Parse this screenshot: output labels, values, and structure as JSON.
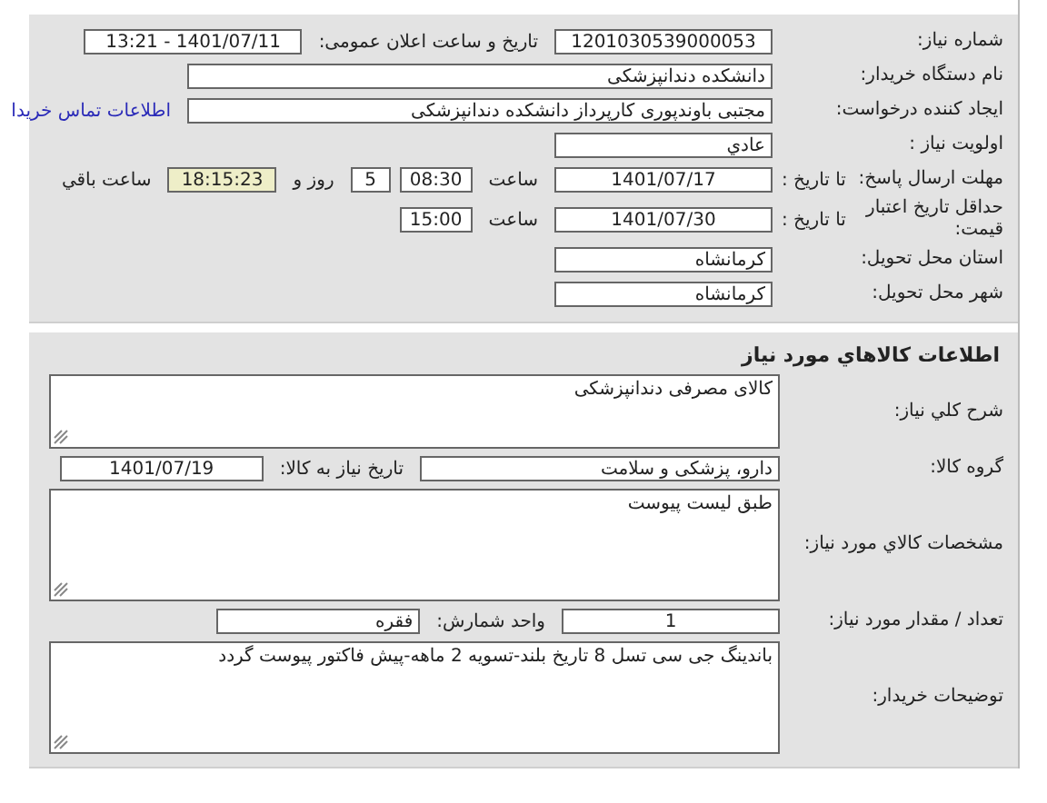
{
  "sections": [
    {
      "rows": [
        {
          "label": "شماره نياز:",
          "items": [
            {
              "kind": "field",
              "value": "1201030539000053"
            },
            {
              "kind": "text",
              "text": "تاريخ و ساعت اعلان عمومی:"
            },
            {
              "kind": "field",
              "value": "1401/07/11 - 13:21"
            }
          ]
        },
        {
          "label": "نام دستگاه خريدار:",
          "items": [
            {
              "kind": "wide",
              "value": "دانشکده دندانپزشکی"
            }
          ]
        },
        {
          "label": "ايجاد کننده درخواست:",
          "items": [
            {
              "kind": "wide",
              "value": "مجتبی  باوندپوری کارپرداز دانشکده دندانپزشکی"
            },
            {
              "kind": "link",
              "text": "اطلاعات تماس خریدا"
            }
          ]
        },
        {
          "label": "اولويت نياز :",
          "items": [
            {
              "kind": "field",
              "value": "عادي"
            }
          ]
        },
        {
          "label": "مهلت ارسال پاسخ:",
          "sublabel": "تا تاريخ :",
          "items": [
            {
              "kind": "field",
              "value": "1401/07/17"
            },
            {
              "kind": "text",
              "text": "ساعت"
            },
            {
              "kind": "small",
              "value": "08:30"
            },
            {
              "kind": "tiny",
              "value": "5"
            },
            {
              "kind": "text",
              "text": "روز و"
            },
            {
              "kind": "timer",
              "value": "18:15:23"
            },
            {
              "kind": "text",
              "text": "ساعت باقي"
            }
          ]
        },
        {
          "label": "حداقل تاريخ اعتبار قيمت:",
          "sublabel": "تا تاريخ :",
          "items": [
            {
              "kind": "field",
              "value": "1401/07/30"
            },
            {
              "kind": "text",
              "text": "ساعت"
            },
            {
              "kind": "small",
              "value": "15:00"
            }
          ]
        },
        {
          "label": "استان محل تحويل:",
          "items": [
            {
              "kind": "field",
              "value": "کرمانشاه"
            }
          ]
        },
        {
          "label": "شهر محل تحويل:",
          "items": [
            {
              "kind": "field",
              "value": "کرمانشاه"
            }
          ]
        }
      ]
    },
    {
      "title": "اطلاعات کالاهاي مورد نياز",
      "rows": [
        {
          "label": "شرح کلي نياز:",
          "items": [
            {
              "kind": "textarea",
              "value": "کالای مصرفی دندانپزشکی"
            }
          ]
        },
        {
          "label": "گروه کالا:",
          "items": [
            {
              "kind": "long",
              "value": "دارو، پزشکی و سلامت"
            },
            {
              "kind": "text",
              "text": "تاريخ نياز به کالا:"
            },
            {
              "kind": "medium",
              "value": "1401/07/19"
            }
          ]
        },
        {
          "label": "مشخصات کالاي مورد نياز:",
          "items": [
            {
              "kind": "textarea",
              "value": "طبق لیست پیوست"
            }
          ]
        },
        {
          "label": "تعداد / مقدار مورد نياز:",
          "items": [
            {
              "kind": "field",
              "value": "1"
            },
            {
              "kind": "text",
              "text": "واحد شمارش:"
            },
            {
              "kind": "medium",
              "value": "فقره"
            }
          ]
        },
        {
          "label": "توضيحات خريدار:",
          "items": [
            {
              "kind": "textarea",
              "value": "باندینگ جی سی تسل 8 تاریخ بلند-تسویه 2 ماهه-پیش فاکتور پیوست گردد"
            }
          ]
        }
      ]
    }
  ]
}
